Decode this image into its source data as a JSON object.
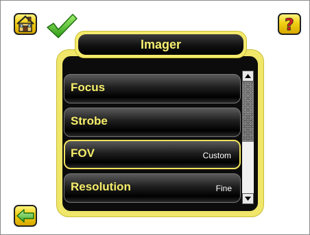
{
  "screen": {
    "title": "Imager"
  },
  "menu": {
    "items": [
      {
        "label": "Focus",
        "value": ""
      },
      {
        "label": "Strobe",
        "value": ""
      },
      {
        "label": "FOV",
        "value": "Custom",
        "selected": true
      },
      {
        "label": "Resolution",
        "value": "Fine"
      }
    ]
  },
  "icons": {
    "home": "home-icon",
    "status": "checkmark-icon",
    "help": "question-mark-icon",
    "back": "back-arrow-icon",
    "scroll_up": "scroll-up-arrow-icon",
    "scroll_down": "scroll-down-arrow-icon"
  },
  "colors": {
    "accent_yellow": "#f4ea6c",
    "label_yellow": "#f6ee6a",
    "check_green": "#4cc02a"
  },
  "help": {
    "glyph": "?"
  }
}
